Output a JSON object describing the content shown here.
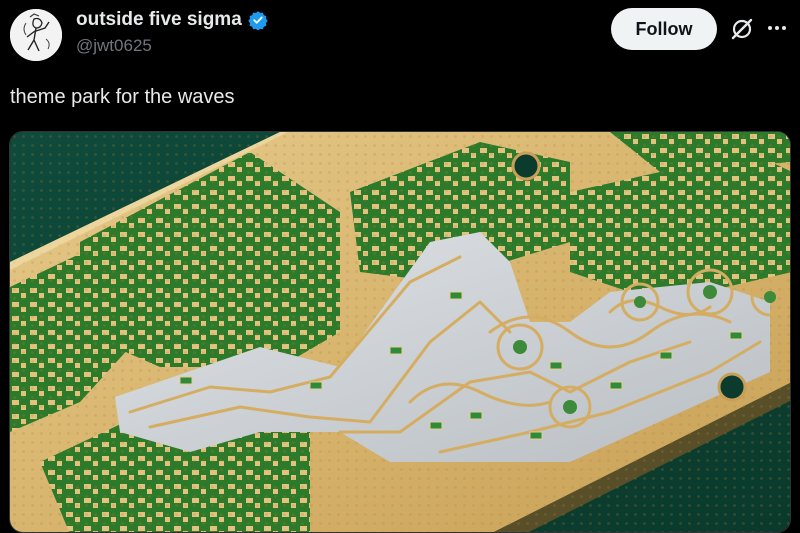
{
  "author": {
    "display_name": "outside five sigma",
    "handle": "@jwt0625",
    "verified": true,
    "avatar_icon": "sketch-figure-avatar"
  },
  "actions": {
    "follow_label": "Follow",
    "grok_icon": "grok-icon",
    "more_icon": "more-horizontal-icon"
  },
  "tweet": {
    "text": "theme park for the waves"
  },
  "media": {
    "description_icon": "circuit-board-photo"
  },
  "colors": {
    "background": "#000000",
    "text_primary": "#e7e9ea",
    "text_secondary": "#71767b",
    "verified_blue": "#1d9bf0",
    "follow_bg": "#eff3f4"
  }
}
